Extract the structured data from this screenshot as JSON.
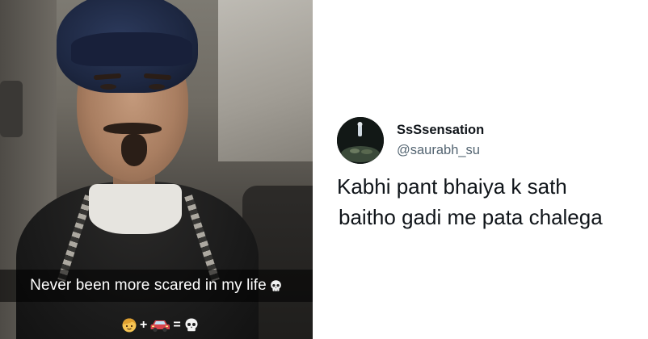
{
  "video": {
    "caption": "Never been more scared in my life",
    "caption_icon": "skull-emoji",
    "equation": {
      "icons": [
        "girl-emoji",
        "car-emoji",
        "skull-emoji"
      ],
      "plus": "+",
      "equals": "="
    }
  },
  "tweet": {
    "display_name": "SsSsensation",
    "username": "@saurabh_su",
    "text_line1": "Kabhi pant bhaiya k sath",
    "text_line2": "baitho gadi me pata chalega",
    "colors": {
      "name": "#0f1419",
      "handle": "#536471"
    }
  }
}
